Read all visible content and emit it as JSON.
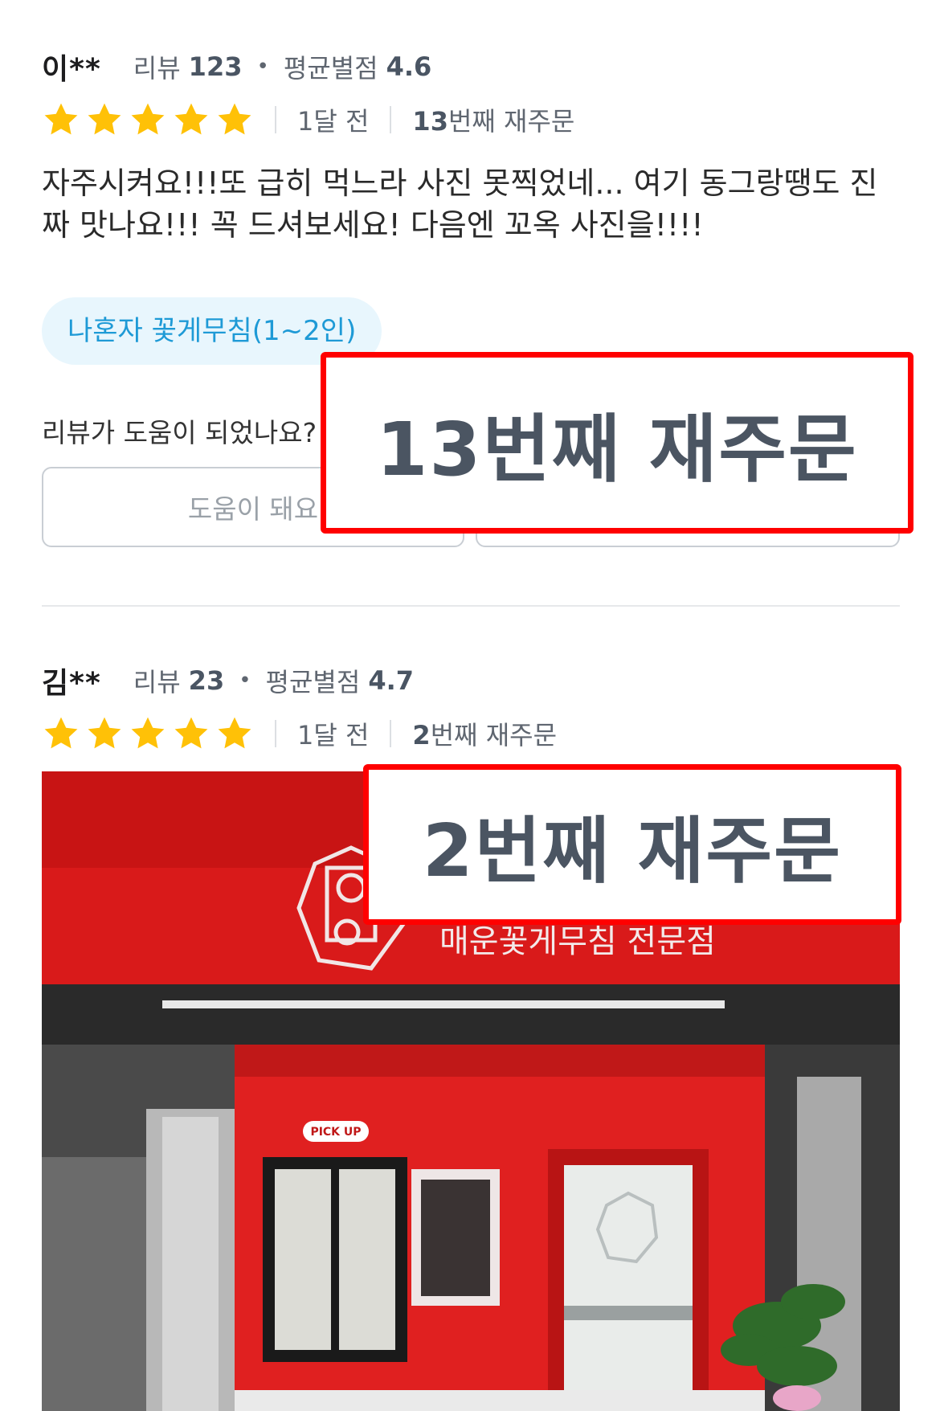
{
  "reviews": [
    {
      "author": "이**",
      "review_label": "리뷰",
      "review_count": "123",
      "avg_label": "평균별점",
      "avg_rating": "4.6",
      "stars": 5,
      "time_ago": "1달 전",
      "reorder_num": "13",
      "reorder_suffix": "번째 재주문",
      "text": "자주시켜요!!!또 급히 먹느라 사진 못찍었네... 여기 동그랑땡도 진짜 맛나요!!! 꼭 드셔보세요! 다음엔 꼬옥 사진을!!!!",
      "menu_chip": "나혼자 꽃게무침(1~2인)"
    },
    {
      "author": "김**",
      "review_label": "리뷰",
      "review_count": "23",
      "avg_label": "평균별점",
      "avg_rating": "4.7",
      "stars": 5,
      "time_ago": "1달 전",
      "reorder_num": "2",
      "reorder_suffix": "번째 재주문"
    }
  ],
  "helpful": {
    "question": "리뷰가 도움이 되었나요?",
    "yes_label": "도움이 돼요"
  },
  "highlights": {
    "first": "13번째 재주문",
    "second": "2번째 재주문"
  },
  "photo": {
    "sign_text": "매운꽃게무침 전문점",
    "pickup_text": "PICK UP"
  },
  "colors": {
    "star": "#FFC107",
    "highlight_border": "#FF0000",
    "chip_bg": "#E8F6FD",
    "chip_text": "#1E9AD6",
    "storefront_red": "#D91A1A"
  }
}
